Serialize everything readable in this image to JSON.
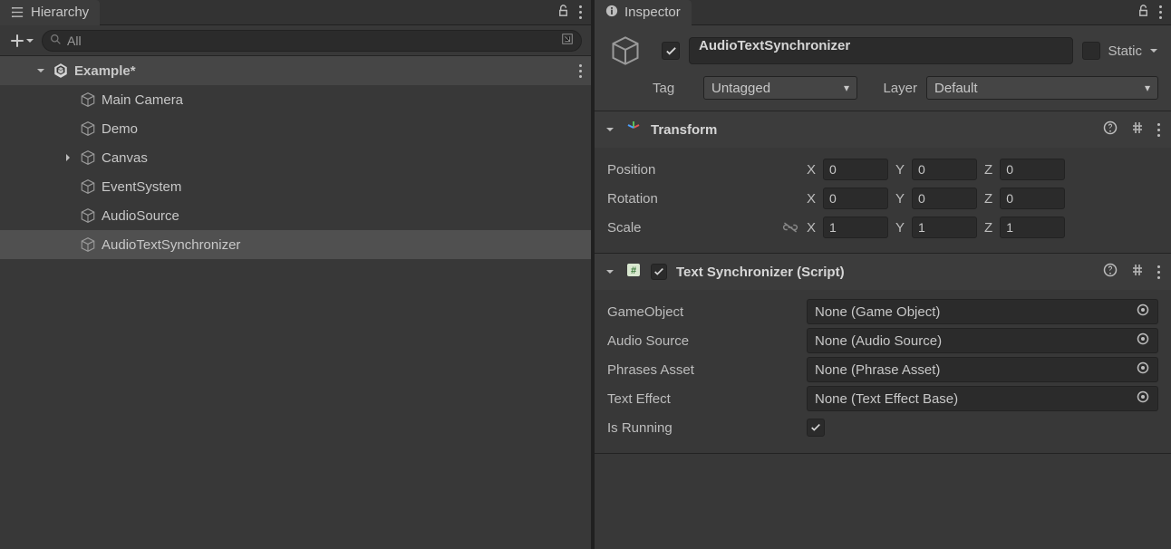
{
  "hierarchy": {
    "tab": "Hierarchy",
    "searchPlaceholder": "All",
    "items": [
      {
        "label": "Example*",
        "indent": 0,
        "arrow": "down",
        "icon": "unity",
        "root": true
      },
      {
        "label": "Main Camera",
        "indent": 1,
        "arrow": "",
        "icon": "cube"
      },
      {
        "label": "Demo",
        "indent": 1,
        "arrow": "",
        "icon": "cube"
      },
      {
        "label": "Canvas",
        "indent": 1,
        "arrow": "right",
        "icon": "cube"
      },
      {
        "label": "EventSystem",
        "indent": 1,
        "arrow": "",
        "icon": "cube"
      },
      {
        "label": "AudioSource",
        "indent": 1,
        "arrow": "",
        "icon": "cube"
      },
      {
        "label": "AudioTextSynchronizer",
        "indent": 1,
        "arrow": "",
        "icon": "cube",
        "selected": true
      }
    ]
  },
  "inspector": {
    "tab": "Inspector",
    "enabled": true,
    "name": "AudioTextSynchronizer",
    "staticLabel": "Static",
    "staticValue": false,
    "tagLabel": "Tag",
    "tagValue": "Untagged",
    "layerLabel": "Layer",
    "layerValue": "Default",
    "transform": {
      "title": "Transform",
      "position": {
        "label": "Position",
        "x": "0",
        "y": "0",
        "z": "0"
      },
      "rotation": {
        "label": "Rotation",
        "x": "0",
        "y": "0",
        "z": "0"
      },
      "scale": {
        "label": "Scale",
        "x": "1",
        "y": "1",
        "z": "1"
      }
    },
    "textSync": {
      "title": "Text Synchronizer (Script)",
      "enabled": true,
      "props": [
        {
          "label": "GameObject",
          "value": "None (Game Object)"
        },
        {
          "label": "Audio Source",
          "value": "None (Audio Source)"
        },
        {
          "label": "Phrases Asset",
          "value": "None (Phrase Asset)"
        },
        {
          "label": "Text Effect",
          "value": "None (Text Effect Base)"
        }
      ],
      "isRunningLabel": "Is Running",
      "isRunningValue": true
    }
  }
}
